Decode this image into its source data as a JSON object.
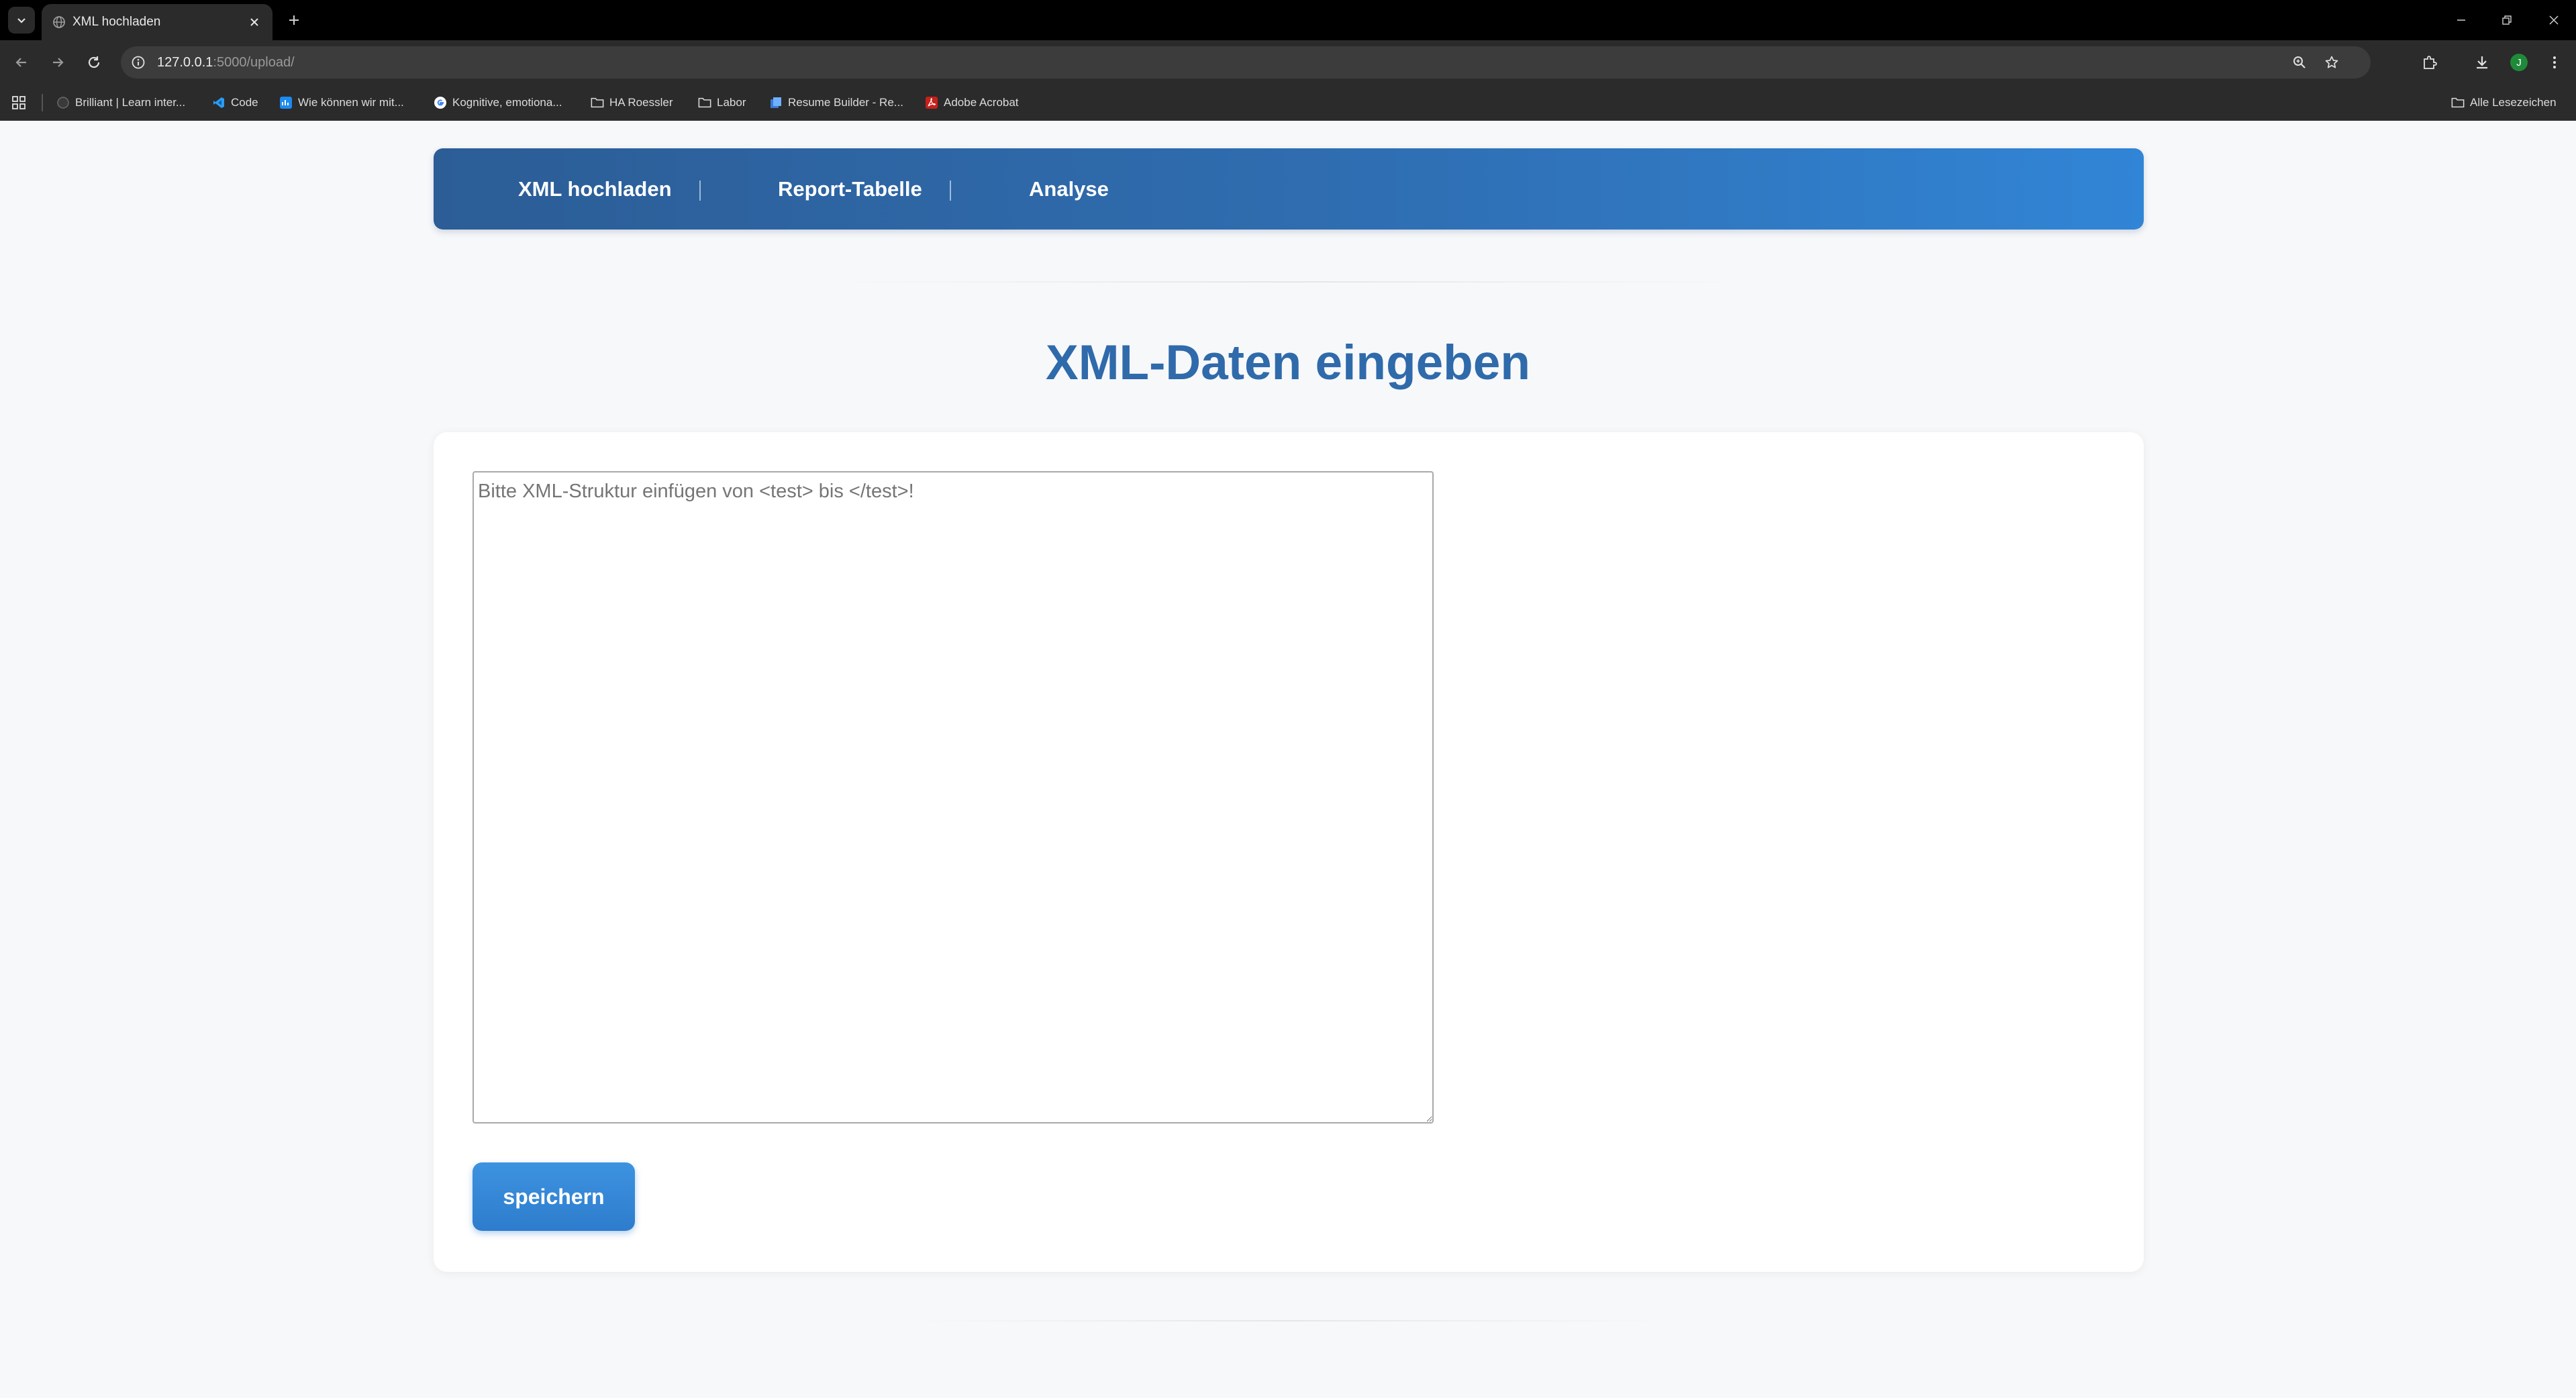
{
  "browser": {
    "tab_title": "XML hochladen",
    "url_host": "127.0.0.1",
    "url_path": ":5000/upload/",
    "bookmarks": [
      {
        "label": "Brilliant | Learn inter...",
        "icon": "brilliant-icon"
      },
      {
        "label": "Code",
        "icon": "vscode-icon"
      },
      {
        "label": "Wie können wir mit...",
        "icon": "chart-app-icon"
      },
      {
        "label": "Kognitive, emotiona...",
        "icon": "google-icon"
      },
      {
        "label": "HA Roessler",
        "icon": "folder-icon"
      },
      {
        "label": "Labor",
        "icon": "folder-icon"
      },
      {
        "label": "Resume Builder - Re...",
        "icon": "resume-builder-icon"
      },
      {
        "label": "Adobe Acrobat",
        "icon": "acrobat-icon"
      }
    ],
    "all_bookmarks_label": "Alle Lesezeichen",
    "profile_initial": "J",
    "profile_color": "#1f8a3a"
  },
  "nav": {
    "items": [
      "XML hochladen",
      "Report-Tabelle",
      "Analyse"
    ],
    "gradient_start": "#2c5d96",
    "gradient_end": "#3185d6"
  },
  "main": {
    "title": "XML-Daten eingeben",
    "title_color": "#2f6aab",
    "textarea_value": "",
    "textarea_placeholder": "Bitte XML-Struktur einfügen von <test> bis </test>!",
    "save_label": "speichern",
    "button_color": "#3389d8"
  }
}
